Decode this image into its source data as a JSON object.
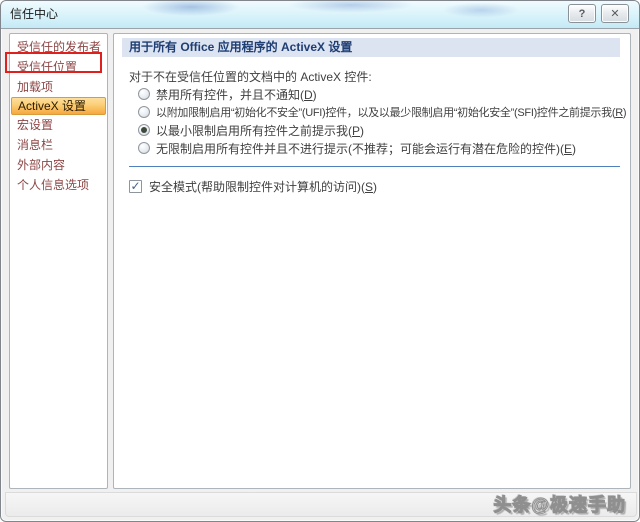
{
  "window": {
    "title": "信任中心",
    "help_glyph": "?",
    "close_glyph": "✕"
  },
  "sidebar": {
    "items": [
      {
        "label": "受信任的发布者",
        "selected": false
      },
      {
        "label": "受信任位置",
        "selected": false,
        "annotated": true
      },
      {
        "label": "加载项",
        "selected": false
      },
      {
        "label": "ActiveX 设置",
        "selected": true
      },
      {
        "label": "宏设置",
        "selected": false
      },
      {
        "label": "消息栏",
        "selected": false
      },
      {
        "label": "外部内容",
        "selected": false
      },
      {
        "label": "个人信息选项",
        "selected": false
      }
    ]
  },
  "main": {
    "header": "用于所有 Office 应用程序的 ActiveX 设置",
    "section_label": "对于不在受信任位置的文档中的 ActiveX 控件:",
    "options": [
      {
        "pre": "禁用所有控件，并且不通知(",
        "key": "D",
        "post": ")",
        "selected": false
      },
      {
        "pre": "以附加限制启用“初始化不安全”(UFI)控件，以及以最少限制启用“初始化安全”(SFI)控件之前提示我(",
        "key": "R",
        "post": ")",
        "selected": false
      },
      {
        "pre": "以最小限制启用所有控件之前提示我(",
        "key": "P",
        "post": ")",
        "selected": true
      },
      {
        "pre": "无限制启用所有控件并且不进行提示(不推荐；可能会运行有潜在危险的控件)(",
        "key": "E",
        "post": ")",
        "selected": false
      }
    ],
    "checkbox": {
      "pre": "安全模式(帮助限制控件对计算机的访问)(",
      "key": "S",
      "post": ")",
      "checked": true,
      "check_glyph": "✓"
    }
  },
  "watermark": "头条@极速手助",
  "colors": {
    "selected_nav_orange": "#F6A83F",
    "header_band_blue": "#DCE3F1",
    "header_text_navy": "#1F3E73",
    "sidebar_text_maroon": "#8C4646",
    "annotation_red": "#E0201C",
    "divider_blue": "#4F81BD",
    "titlebar_aero_blue": "#C4EAF6"
  }
}
